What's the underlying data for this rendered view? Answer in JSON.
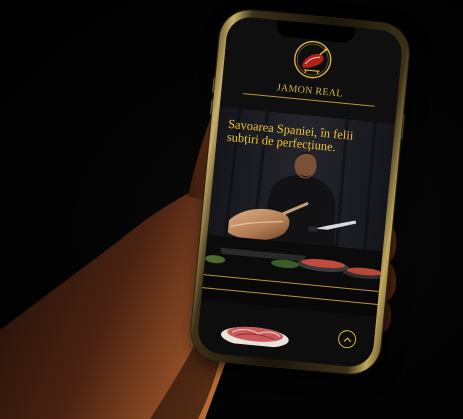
{
  "app": {
    "brand_name": "JAMON REAL",
    "hero_tagline": "Savoarea Spaniei, în felii subțiri de perfecțiune."
  },
  "icons": {
    "logo": "ham-emblem-icon",
    "scroll_top": "chevron-up-icon"
  },
  "colors": {
    "accent_gold": "#d7b24b",
    "tagline_yellow": "#f1c232",
    "background": "#0c0c0c"
  }
}
